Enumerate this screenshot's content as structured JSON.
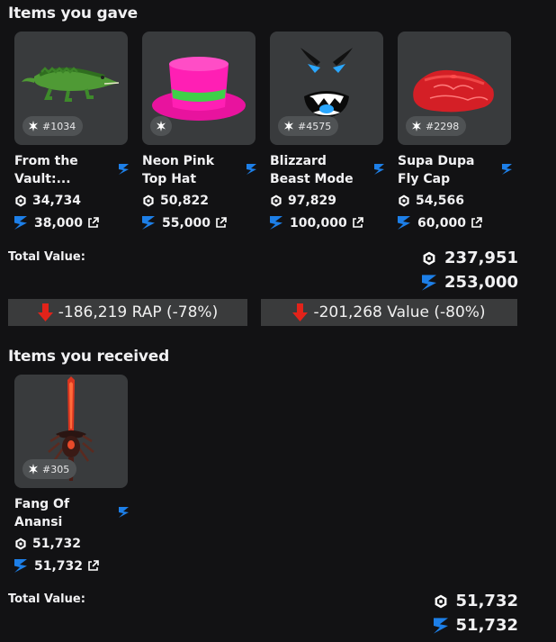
{
  "gave": {
    "title": "Items you gave",
    "items": [
      {
        "name": "From the Vault:...",
        "serial": "#1034",
        "rap": "34,734",
        "value": "38,000"
      },
      {
        "name": "Neon Pink Top Hat",
        "serial": "",
        "rap": "50,822",
        "value": "55,000"
      },
      {
        "name": "Blizzard Beast Mode",
        "serial": "#4575",
        "rap": "97,829",
        "value": "100,000"
      },
      {
        "name": "Supa Dupa Fly Cap",
        "serial": "#2298",
        "rap": "54,566",
        "value": "60,000"
      }
    ],
    "total_label": "Total Value:",
    "total_rap": "237,951",
    "total_value": "253,000"
  },
  "diff": {
    "rap": "-186,219 RAP (-78%)",
    "value": "-201,268 Value (-80%)"
  },
  "received": {
    "title": "Items you received",
    "items": [
      {
        "name": "Fang Of Anansi",
        "serial": "#305",
        "rap": "51,732",
        "value": "51,732"
      }
    ],
    "total_label": "Total Value:",
    "total_rap": "51,732",
    "total_value": "51,732"
  },
  "colors": {
    "background": "#121214",
    "card": "#393b3d",
    "value_icon": "#1d7fe8",
    "down_arrow": "#e2231a"
  }
}
